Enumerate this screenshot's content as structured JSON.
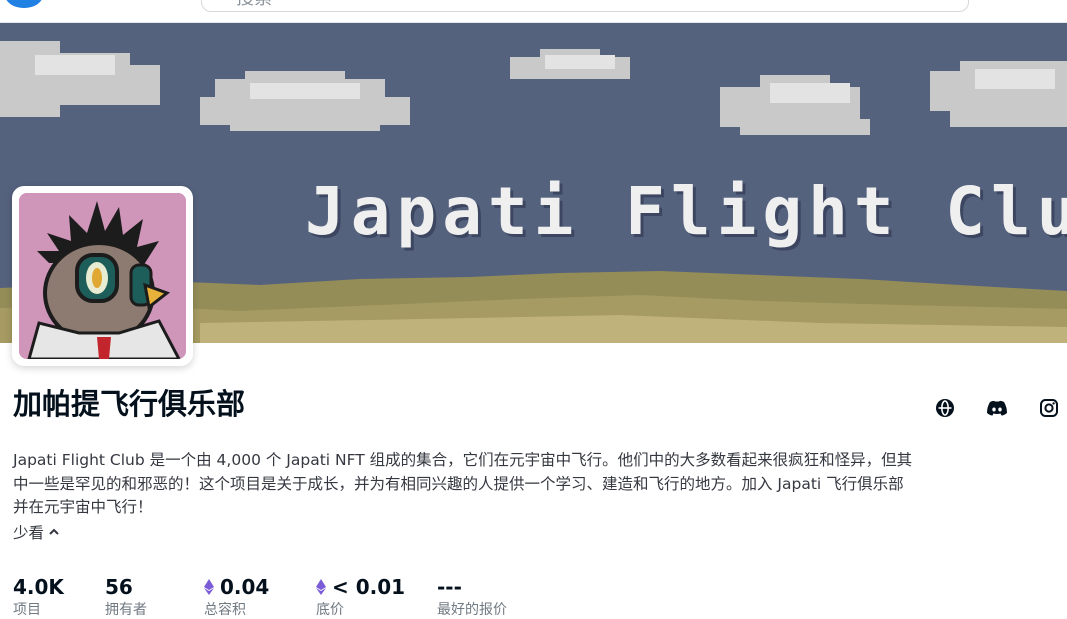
{
  "header": {
    "search_placeholder": "搜索"
  },
  "banner": {
    "title": "Japati Flight Club"
  },
  "collection": {
    "name": "加帕提飞行俱乐部",
    "description": "Japati Flight Club 是一个由 4,000 个 Japati NFT 组成的集合，它们在元宇宙中飞行。他们中的大多数看起来很疯狂和怪异，但其中一些是罕见的和邪恶的！这个项目是关于成长，并为有相同兴趣的人提供一个学习、建造和飞行的地方。加入 Japati 飞行俱乐部并在元宇宙中飞行！",
    "toggle_label": "少看"
  },
  "socials": [
    {
      "icon": "website-icon"
    },
    {
      "icon": "discord-icon"
    },
    {
      "icon": "instagram-icon"
    }
  ],
  "stats": [
    {
      "value": "4.0K",
      "label": "项目",
      "currency": ""
    },
    {
      "value": "56",
      "label": "拥有者",
      "currency": ""
    },
    {
      "value": "0.04",
      "label": "总容积",
      "currency": "eth-icon"
    },
    {
      "value": "< 0.01",
      "label": "底价",
      "currency": "eth-icon"
    },
    {
      "value": "---",
      "label": "最好的报价",
      "currency": ""
    }
  ],
  "colors": {
    "sky": "#55627e",
    "ground": "#958d58",
    "avatar_bg": "#cf96ba",
    "eth": "#7b5cd6"
  }
}
